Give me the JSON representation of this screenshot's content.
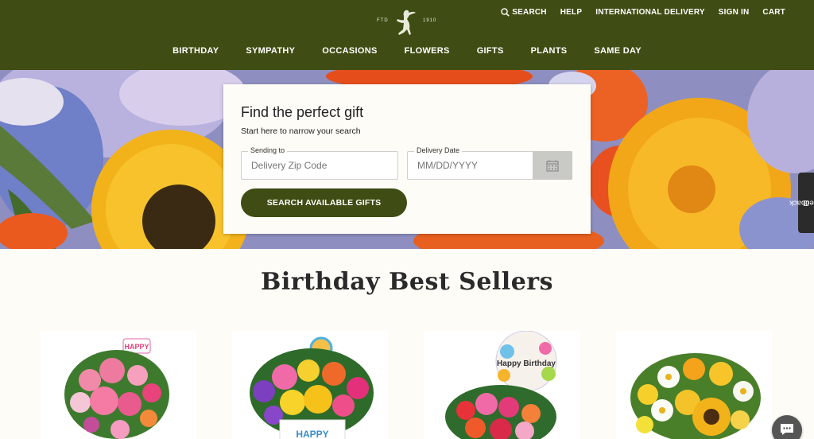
{
  "header": {
    "logo": {
      "left_text": "FTD",
      "right_text": "1910",
      "icon": "mercury-man-logo-icon"
    },
    "utility_nav": [
      {
        "label": "SEARCH",
        "icon": "search-icon"
      },
      {
        "label": "HELP"
      },
      {
        "label": "INTERNATIONAL DELIVERY"
      },
      {
        "label": "SIGN IN"
      },
      {
        "label": "CART"
      }
    ],
    "main_nav": [
      "BIRTHDAY",
      "SYMPATHY",
      "OCCASIONS",
      "FLOWERS",
      "GIFTS",
      "PLANTS",
      "SAME DAY"
    ]
  },
  "search_card": {
    "title": "Find the perfect gift",
    "subtitle": "Start here to narrow your search",
    "zip_label": "Sending to",
    "zip_placeholder": "Delivery Zip Code",
    "date_label": "Delivery Date",
    "date_placeholder": "MM/DD/YYYY",
    "calendar_icon": "calendar-icon",
    "button_label": "SEARCH AVAILABLE GIFTS"
  },
  "feedback": {
    "label": "Feedback",
    "icon": "feedback-icon"
  },
  "best_sellers": {
    "title": "Birthday Best Sellers",
    "products": [
      {
        "name": "pink-lily-birthday-bouquet",
        "pick_text": "HAPPY"
      },
      {
        "name": "bright-birthday-bouquet-in-mug",
        "mug_text": "HAPPY"
      },
      {
        "name": "happy-birthday-balloon-bouquet",
        "balloon_text": "Happy Birthday"
      },
      {
        "name": "sunflower-daisy-bouquet"
      }
    ]
  },
  "chat": {
    "icon": "chat-icon"
  },
  "colors": {
    "brand_green": "#3f4d14",
    "cream": "#fdfcf6"
  }
}
